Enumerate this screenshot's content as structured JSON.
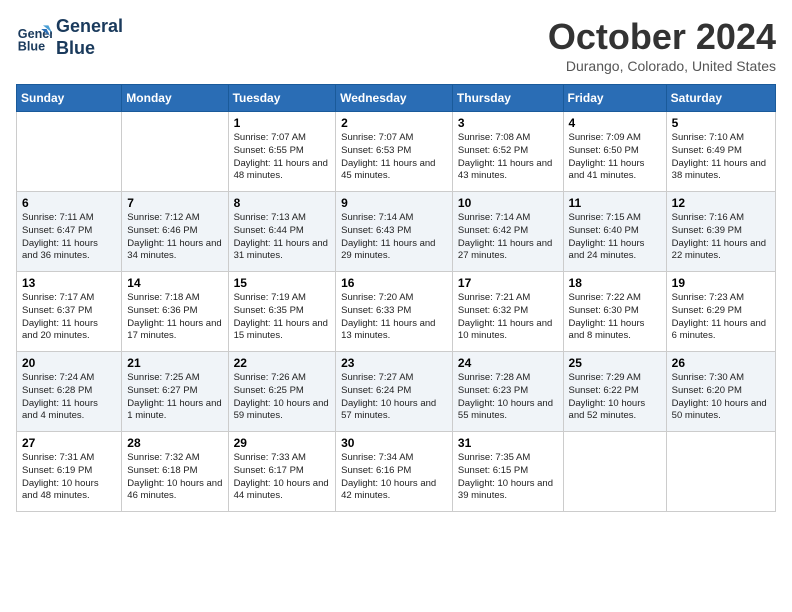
{
  "logo": {
    "line1": "General",
    "line2": "Blue"
  },
  "title": "October 2024",
  "location": "Durango, Colorado, United States",
  "days_header": [
    "Sunday",
    "Monday",
    "Tuesday",
    "Wednesday",
    "Thursday",
    "Friday",
    "Saturday"
  ],
  "weeks": [
    [
      {
        "num": "",
        "sunrise": "",
        "sunset": "",
        "daylight": ""
      },
      {
        "num": "",
        "sunrise": "",
        "sunset": "",
        "daylight": ""
      },
      {
        "num": "1",
        "sunrise": "Sunrise: 7:07 AM",
        "sunset": "Sunset: 6:55 PM",
        "daylight": "Daylight: 11 hours and 48 minutes."
      },
      {
        "num": "2",
        "sunrise": "Sunrise: 7:07 AM",
        "sunset": "Sunset: 6:53 PM",
        "daylight": "Daylight: 11 hours and 45 minutes."
      },
      {
        "num": "3",
        "sunrise": "Sunrise: 7:08 AM",
        "sunset": "Sunset: 6:52 PM",
        "daylight": "Daylight: 11 hours and 43 minutes."
      },
      {
        "num": "4",
        "sunrise": "Sunrise: 7:09 AM",
        "sunset": "Sunset: 6:50 PM",
        "daylight": "Daylight: 11 hours and 41 minutes."
      },
      {
        "num": "5",
        "sunrise": "Sunrise: 7:10 AM",
        "sunset": "Sunset: 6:49 PM",
        "daylight": "Daylight: 11 hours and 38 minutes."
      }
    ],
    [
      {
        "num": "6",
        "sunrise": "Sunrise: 7:11 AM",
        "sunset": "Sunset: 6:47 PM",
        "daylight": "Daylight: 11 hours and 36 minutes."
      },
      {
        "num": "7",
        "sunrise": "Sunrise: 7:12 AM",
        "sunset": "Sunset: 6:46 PM",
        "daylight": "Daylight: 11 hours and 34 minutes."
      },
      {
        "num": "8",
        "sunrise": "Sunrise: 7:13 AM",
        "sunset": "Sunset: 6:44 PM",
        "daylight": "Daylight: 11 hours and 31 minutes."
      },
      {
        "num": "9",
        "sunrise": "Sunrise: 7:14 AM",
        "sunset": "Sunset: 6:43 PM",
        "daylight": "Daylight: 11 hours and 29 minutes."
      },
      {
        "num": "10",
        "sunrise": "Sunrise: 7:14 AM",
        "sunset": "Sunset: 6:42 PM",
        "daylight": "Daylight: 11 hours and 27 minutes."
      },
      {
        "num": "11",
        "sunrise": "Sunrise: 7:15 AM",
        "sunset": "Sunset: 6:40 PM",
        "daylight": "Daylight: 11 hours and 24 minutes."
      },
      {
        "num": "12",
        "sunrise": "Sunrise: 7:16 AM",
        "sunset": "Sunset: 6:39 PM",
        "daylight": "Daylight: 11 hours and 22 minutes."
      }
    ],
    [
      {
        "num": "13",
        "sunrise": "Sunrise: 7:17 AM",
        "sunset": "Sunset: 6:37 PM",
        "daylight": "Daylight: 11 hours and 20 minutes."
      },
      {
        "num": "14",
        "sunrise": "Sunrise: 7:18 AM",
        "sunset": "Sunset: 6:36 PM",
        "daylight": "Daylight: 11 hours and 17 minutes."
      },
      {
        "num": "15",
        "sunrise": "Sunrise: 7:19 AM",
        "sunset": "Sunset: 6:35 PM",
        "daylight": "Daylight: 11 hours and 15 minutes."
      },
      {
        "num": "16",
        "sunrise": "Sunrise: 7:20 AM",
        "sunset": "Sunset: 6:33 PM",
        "daylight": "Daylight: 11 hours and 13 minutes."
      },
      {
        "num": "17",
        "sunrise": "Sunrise: 7:21 AM",
        "sunset": "Sunset: 6:32 PM",
        "daylight": "Daylight: 11 hours and 10 minutes."
      },
      {
        "num": "18",
        "sunrise": "Sunrise: 7:22 AM",
        "sunset": "Sunset: 6:30 PM",
        "daylight": "Daylight: 11 hours and 8 minutes."
      },
      {
        "num": "19",
        "sunrise": "Sunrise: 7:23 AM",
        "sunset": "Sunset: 6:29 PM",
        "daylight": "Daylight: 11 hours and 6 minutes."
      }
    ],
    [
      {
        "num": "20",
        "sunrise": "Sunrise: 7:24 AM",
        "sunset": "Sunset: 6:28 PM",
        "daylight": "Daylight: 11 hours and 4 minutes."
      },
      {
        "num": "21",
        "sunrise": "Sunrise: 7:25 AM",
        "sunset": "Sunset: 6:27 PM",
        "daylight": "Daylight: 11 hours and 1 minute."
      },
      {
        "num": "22",
        "sunrise": "Sunrise: 7:26 AM",
        "sunset": "Sunset: 6:25 PM",
        "daylight": "Daylight: 10 hours and 59 minutes."
      },
      {
        "num": "23",
        "sunrise": "Sunrise: 7:27 AM",
        "sunset": "Sunset: 6:24 PM",
        "daylight": "Daylight: 10 hours and 57 minutes."
      },
      {
        "num": "24",
        "sunrise": "Sunrise: 7:28 AM",
        "sunset": "Sunset: 6:23 PM",
        "daylight": "Daylight: 10 hours and 55 minutes."
      },
      {
        "num": "25",
        "sunrise": "Sunrise: 7:29 AM",
        "sunset": "Sunset: 6:22 PM",
        "daylight": "Daylight: 10 hours and 52 minutes."
      },
      {
        "num": "26",
        "sunrise": "Sunrise: 7:30 AM",
        "sunset": "Sunset: 6:20 PM",
        "daylight": "Daylight: 10 hours and 50 minutes."
      }
    ],
    [
      {
        "num": "27",
        "sunrise": "Sunrise: 7:31 AM",
        "sunset": "Sunset: 6:19 PM",
        "daylight": "Daylight: 10 hours and 48 minutes."
      },
      {
        "num": "28",
        "sunrise": "Sunrise: 7:32 AM",
        "sunset": "Sunset: 6:18 PM",
        "daylight": "Daylight: 10 hours and 46 minutes."
      },
      {
        "num": "29",
        "sunrise": "Sunrise: 7:33 AM",
        "sunset": "Sunset: 6:17 PM",
        "daylight": "Daylight: 10 hours and 44 minutes."
      },
      {
        "num": "30",
        "sunrise": "Sunrise: 7:34 AM",
        "sunset": "Sunset: 6:16 PM",
        "daylight": "Daylight: 10 hours and 42 minutes."
      },
      {
        "num": "31",
        "sunrise": "Sunrise: 7:35 AM",
        "sunset": "Sunset: 6:15 PM",
        "daylight": "Daylight: 10 hours and 39 minutes."
      },
      {
        "num": "",
        "sunrise": "",
        "sunset": "",
        "daylight": ""
      },
      {
        "num": "",
        "sunrise": "",
        "sunset": "",
        "daylight": ""
      }
    ]
  ]
}
